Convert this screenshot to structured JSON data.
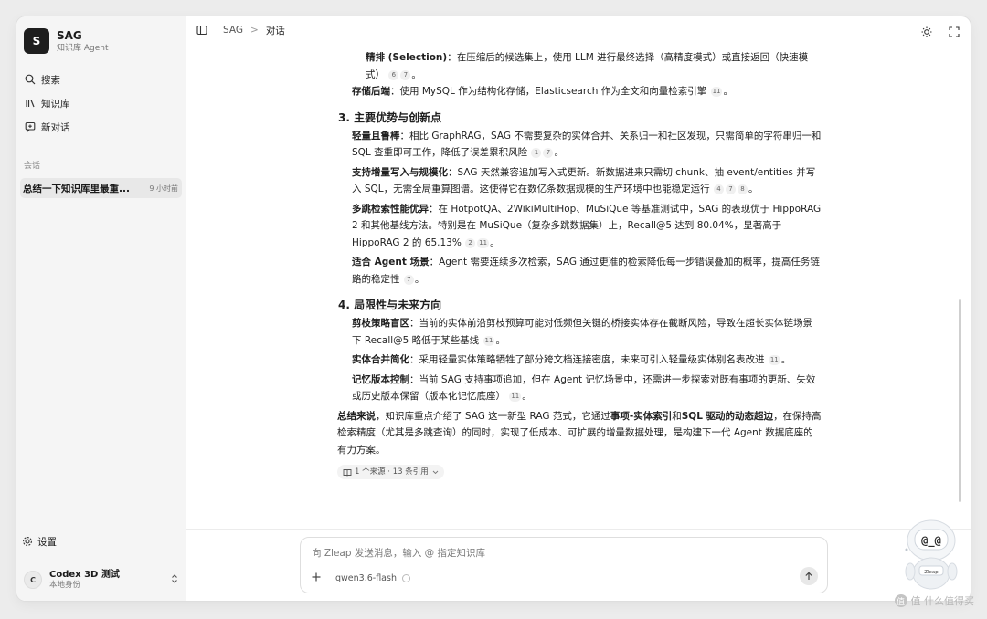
{
  "brand": {
    "logo_letter": "S",
    "name": "SAG",
    "subtitle": "知识库 Agent"
  },
  "nav": [
    {
      "label": "搜索",
      "icon": "search-icon"
    },
    {
      "label": "知识库",
      "icon": "library-icon"
    },
    {
      "label": "新对话",
      "icon": "new-chat-icon"
    }
  ],
  "conversations": {
    "section_label": "会话",
    "items": [
      {
        "title": "总结一下知识库里最重...",
        "time": "9 小时前"
      }
    ]
  },
  "settings_label": "设置",
  "user": {
    "avatar_letter": "C",
    "name": "Codex 3D 测试",
    "role": "本地身份"
  },
  "breadcrumb": {
    "root": "SAG",
    "separator": ">",
    "current": "对话"
  },
  "message": {
    "p1_b": "精排 (Selection)",
    "p1_t": "：在压缩后的候选集上，使用 LLM 进行最终选择（高精度模式）或直接返回（快速模式）",
    "p1_c": [
      "6",
      "7"
    ],
    "p1_end": "。",
    "p2_b": "存储后端",
    "p2_t": "：使用 MySQL 作为结构化存储，Elasticsearch 作为全文和向量检索引擎",
    "p2_c": [
      "11"
    ],
    "p2_end": "。",
    "h3": "3. 主要优势与创新点",
    "a1_b": "轻量且鲁棒",
    "a1_t": "：相比 GraphRAG，SAG 不需要复杂的实体合并、关系归一和社区发现，只需简单的字符串归一和 SQL 查重即可工作，降低了误差累积风险",
    "a1_c": [
      "1",
      "7"
    ],
    "a1_end": "。",
    "a2_b": "支持增量写入与规模化",
    "a2_t": "：SAG 天然兼容追加写入式更新。新数据进来只需切 chunk、抽 event/entities 并写入 SQL，无需全局重算图谱。这使得它在数亿条数据规模的生产环境中也能稳定运行",
    "a2_c": [
      "4",
      "7",
      "8"
    ],
    "a2_end": "。",
    "a3_b": "多跳检索性能优异",
    "a3_t": "：在 HotpotQA、2WikiMultiHop、MuSiQue 等基准测试中，SAG 的表现优于 HippoRAG 2 和其他基线方法。特别是在 MuSiQue（复杂多跳数据集）上，Recall@5 达到 80.04%，显著高于 HippoRAG 2 的 65.13%",
    "a3_c": [
      "2",
      "11"
    ],
    "a3_end": "。",
    "a4_b": "适合 Agent 场景",
    "a4_t": "：Agent 需要连续多次检索，SAG 通过更准的检索降低每一步错误叠加的概率，提高任务链路的稳定性",
    "a4_c": [
      "7"
    ],
    "a4_end": "。",
    "h4": "4. 局限性与未来方向",
    "l1_b": "剪枝策略盲区",
    "l1_t": "：当前的实体前沿剪枝预算可能对低频但关键的桥接实体存在截断风险，导致在超长实体链场景下 Recall@5 略低于某些基线",
    "l1_c": [
      "11"
    ],
    "l1_end": "。",
    "l2_b": "实体合并简化",
    "l2_t": "：采用轻量实体策略牺牲了部分跨文档连接密度，未来可引入轻量级实体别名表改进",
    "l2_c": [
      "11"
    ],
    "l2_end": "。",
    "l3_b": "记忆版本控制",
    "l3_t": "：当前 SAG 支持事项追加，但在 Agent 记忆场景中，还需进一步探索对既有事项的更新、失效或历史版本保留（版本化记忆底座）",
    "l3_c": [
      "11"
    ],
    "l3_end": "。",
    "s_b1": "总结来说",
    "s_t1": "，知识库重点介绍了 SAG 这一新型 RAG 范式，它通过",
    "s_b2": "事项-实体索引",
    "s_t2": "和",
    "s_b3": "SQL 驱动的动态超边",
    "s_t3": "，在保持高检索精度（尤其是多跳查询）的同时，实现了低成本、可扩展的增量数据处理，是构建下一代 Agent 数据底座的有力方案。",
    "sources_label": "1 个来源 · 13 条引用"
  },
  "composer": {
    "placeholder": "向 Zleap 发送消息，输入 @ 指定知识库",
    "model": "qwen3.6-flash"
  },
  "mascot": {
    "badge": "Zleap"
  },
  "watermark": "值 什么值得买"
}
